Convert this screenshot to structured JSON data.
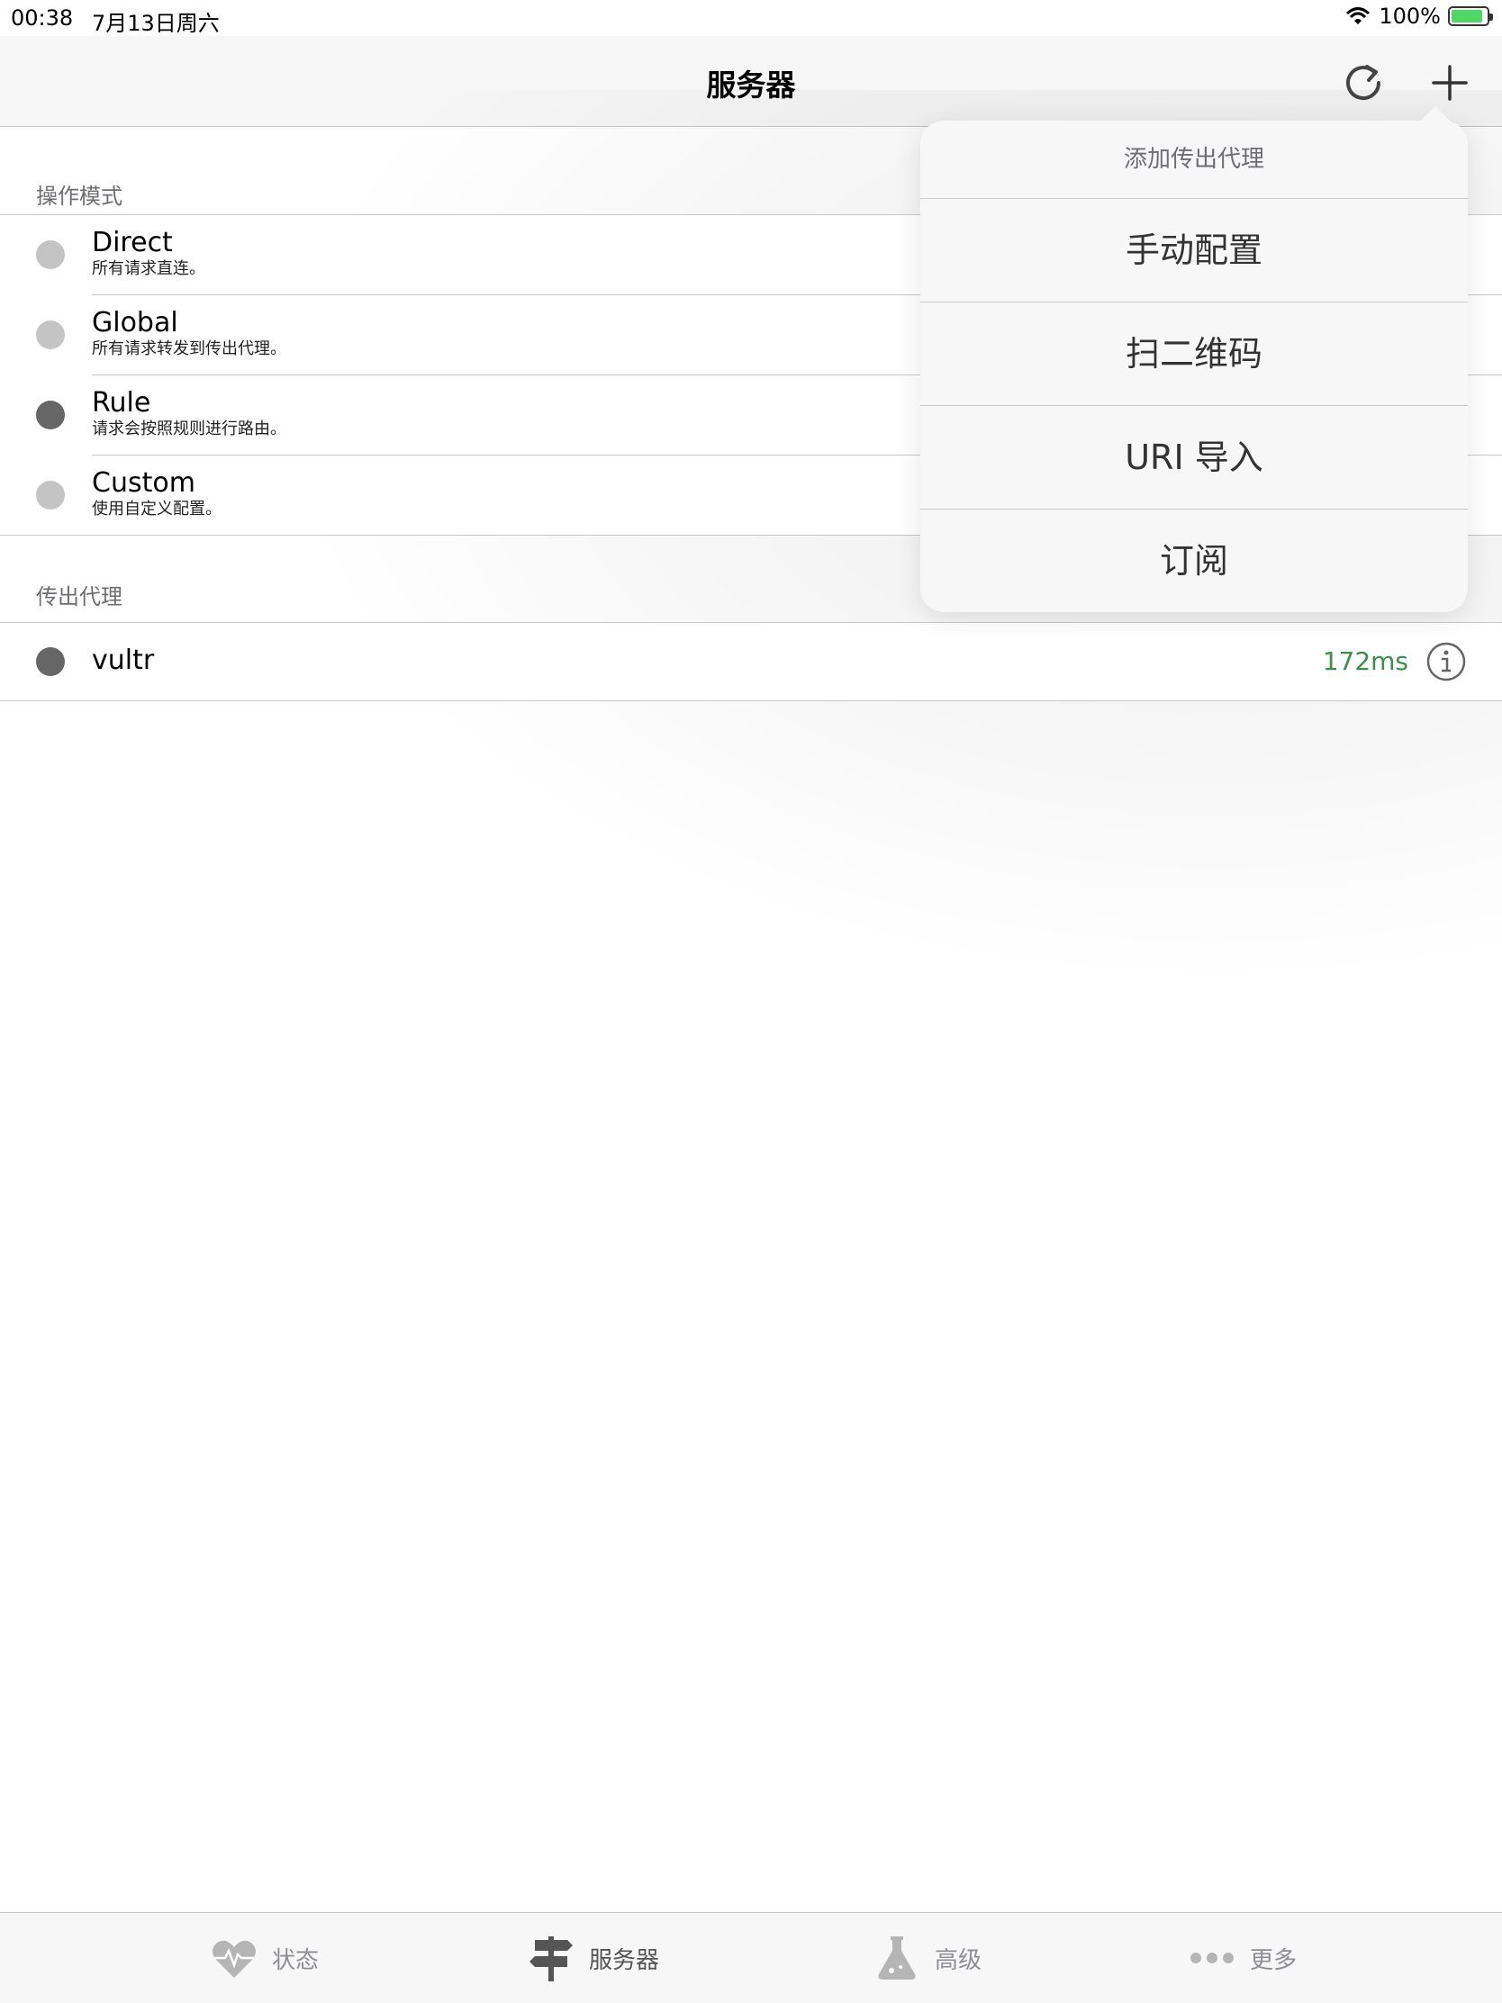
{
  "status_bar": {
    "time": "00:38",
    "date": "7月13日周六",
    "battery": "100%",
    "battery_level": 0.9
  },
  "nav": {
    "title": "服务器"
  },
  "operation_mode": {
    "header": "操作模式",
    "items": [
      {
        "title": "Direct",
        "subtitle": "所有请求直连。",
        "selected": false
      },
      {
        "title": "Global",
        "subtitle": "所有请求转发到传出代理。",
        "selected": false
      },
      {
        "title": "Rule",
        "subtitle": "请求会按照规则进行路由。",
        "selected": true
      },
      {
        "title": "Custom",
        "subtitle": "使用自定义配置。",
        "selected": false
      }
    ]
  },
  "outbound": {
    "header": "传出代理",
    "proxies": [
      {
        "name": "vultr",
        "latency": "172ms"
      }
    ]
  },
  "popover": {
    "title": "添加传出代理",
    "items": [
      "手动配置",
      "扫二维码",
      "URI 导入",
      "订阅"
    ]
  },
  "tabbar": {
    "tabs": [
      {
        "label": "状态",
        "icon": "heart-pulse-icon"
      },
      {
        "label": "服务器",
        "icon": "signpost-icon"
      },
      {
        "label": "高级",
        "icon": "flask-icon"
      },
      {
        "label": "更多",
        "icon": "more-dots-icon"
      }
    ]
  },
  "colors": {
    "accent_green": "#3a8f4a",
    "dot_selected": "#666666",
    "dot_unselected": "#c4c4c4"
  }
}
